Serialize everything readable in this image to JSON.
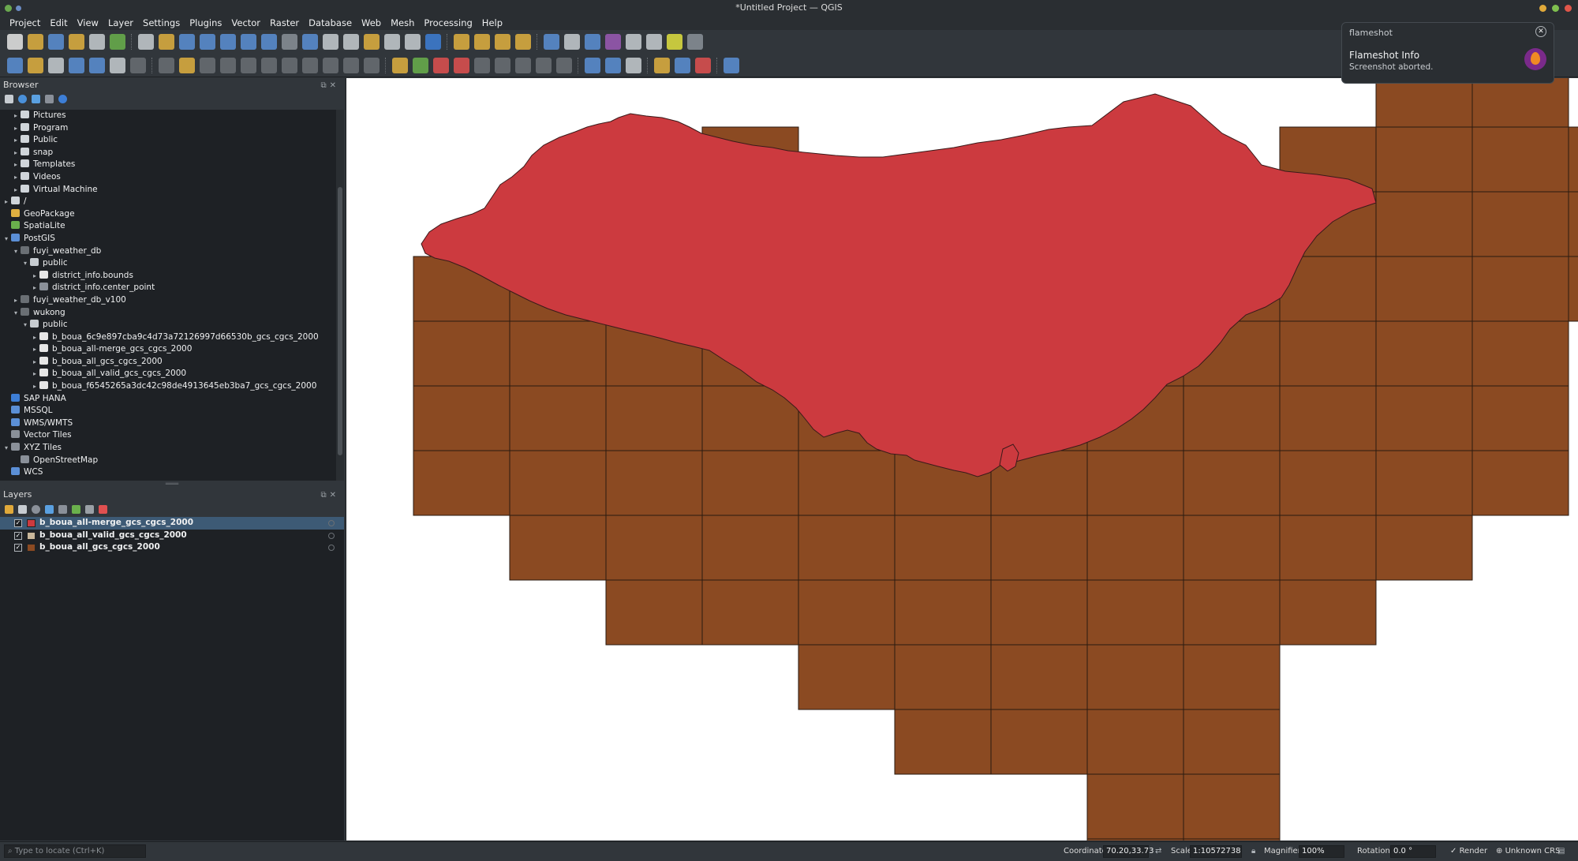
{
  "window": {
    "title": "*Untitled Project — QGIS"
  },
  "menubar": [
    "Project",
    "Edit",
    "View",
    "Layer",
    "Settings",
    "Plugins",
    "Vector",
    "Raster",
    "Database",
    "Web",
    "Mesh",
    "Processing",
    "Help"
  ],
  "browser": {
    "title": "Browser",
    "items": [
      {
        "label": "Pictures",
        "indent": 1,
        "arrow": "▸",
        "icon": "folder-icon"
      },
      {
        "label": "Program",
        "indent": 1,
        "arrow": "▸",
        "icon": "folder-icon"
      },
      {
        "label": "Public",
        "indent": 1,
        "arrow": "▸",
        "icon": "folder-icon"
      },
      {
        "label": "snap",
        "indent": 1,
        "arrow": "▸",
        "icon": "folder-icon"
      },
      {
        "label": "Templates",
        "indent": 1,
        "arrow": "▸",
        "icon": "folder-icon"
      },
      {
        "label": "Videos",
        "indent": 1,
        "arrow": "▸",
        "icon": "folder-icon"
      },
      {
        "label": "Virtual Machine",
        "indent": 1,
        "arrow": "▸",
        "icon": "folder-icon"
      },
      {
        "label": "/",
        "indent": 0,
        "arrow": "▸",
        "icon": "folder-icon"
      },
      {
        "label": "GeoPackage",
        "indent": 0,
        "arrow": "",
        "icon": "geopackage-icon"
      },
      {
        "label": "SpatiaLite",
        "indent": 0,
        "arrow": "",
        "icon": "spatialite-icon"
      },
      {
        "label": "PostGIS",
        "indent": 0,
        "arrow": "▾",
        "icon": "postgis-icon"
      },
      {
        "label": "fuyi_weather_db",
        "indent": 1,
        "arrow": "▾",
        "icon": "connection-icon"
      },
      {
        "label": "public",
        "indent": 2,
        "arrow": "▾",
        "icon": "schema-icon"
      },
      {
        "label": "district_info.bounds",
        "indent": 3,
        "arrow": "▸",
        "icon": "polygon-layer-icon"
      },
      {
        "label": "district_info.center_point",
        "indent": 3,
        "arrow": "▸",
        "icon": "point-layer-icon"
      },
      {
        "label": "fuyi_weather_db_v100",
        "indent": 1,
        "arrow": "▸",
        "icon": "connection-icon"
      },
      {
        "label": "wukong",
        "indent": 1,
        "arrow": "▾",
        "icon": "connection-icon"
      },
      {
        "label": "public",
        "indent": 2,
        "arrow": "▾",
        "icon": "schema-icon"
      },
      {
        "label": "b_boua_6c9e897cba9c4d73a72126997d66530b_gcs_cgcs_2000",
        "indent": 3,
        "arrow": "▸",
        "icon": "polygon-layer-icon"
      },
      {
        "label": "b_boua_all-merge_gcs_cgcs_2000",
        "indent": 3,
        "arrow": "▸",
        "icon": "polygon-layer-icon"
      },
      {
        "label": "b_boua_all_gcs_cgcs_2000",
        "indent": 3,
        "arrow": "▸",
        "icon": "polygon-layer-icon"
      },
      {
        "label": "b_boua_all_valid_gcs_cgcs_2000",
        "indent": 3,
        "arrow": "▸",
        "icon": "polygon-layer-icon"
      },
      {
        "label": "b_boua_f6545265a3dc42c98de4913645eb3ba7_gcs_cgcs_2000",
        "indent": 3,
        "arrow": "▸",
        "icon": "polygon-layer-icon"
      },
      {
        "label": "SAP HANA",
        "indent": 0,
        "arrow": "",
        "icon": "sap-hana-icon"
      },
      {
        "label": "MSSQL",
        "indent": 0,
        "arrow": "",
        "icon": "mssql-icon"
      },
      {
        "label": "WMS/WMTS",
        "indent": 0,
        "arrow": "",
        "icon": "wms-icon"
      },
      {
        "label": "Vector Tiles",
        "indent": 0,
        "arrow": "",
        "icon": "vector-tiles-icon"
      },
      {
        "label": "XYZ Tiles",
        "indent": 0,
        "arrow": "▾",
        "icon": "xyz-tiles-icon"
      },
      {
        "label": "OpenStreetMap",
        "indent": 1,
        "arrow": "",
        "icon": "xyz-tiles-icon"
      },
      {
        "label": "WCS",
        "indent": 0,
        "arrow": "",
        "icon": "wcs-icon"
      }
    ]
  },
  "layers": {
    "title": "Layers",
    "items": [
      {
        "label": "b_boua_all-merge_gcs_cgcs_2000",
        "checked": true,
        "color": "#cc3a3f",
        "selected": true
      },
      {
        "label": "b_boua_all_valid_gcs_cgcs_2000",
        "checked": true,
        "color": "#c9b79a",
        "selected": false
      },
      {
        "label": "b_boua_all_gcs_cgcs_2000",
        "checked": true,
        "color": "#8b4a22",
        "selected": false
      }
    ]
  },
  "map": {
    "grid_color": "#8b4a22",
    "region_color": "#cc3a3f",
    "background": "#ffffff"
  },
  "statusbar": {
    "locate_placeholder": "Type to locate (Ctrl+K)",
    "coordinate_label": "Coordinate",
    "coordinate_value": "70.20,33.73",
    "scale_label": "Scale",
    "scale_value": "1:10572738",
    "magnifier_label": "Magnifier",
    "magnifier_value": "100%",
    "rotation_label": "Rotation",
    "rotation_value": "0.0 °",
    "render_label": "Render",
    "crs_label": "Unknown CRS"
  },
  "notification": {
    "app": "flameshot",
    "title": "Flameshot Info",
    "body": "Screenshot aborted."
  }
}
